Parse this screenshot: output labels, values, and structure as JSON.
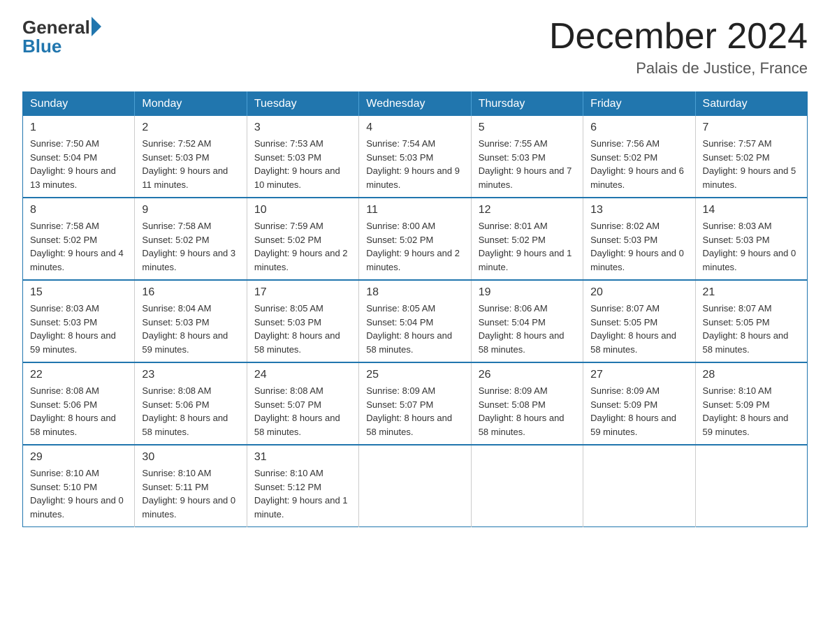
{
  "header": {
    "logo_general": "General",
    "logo_blue": "Blue",
    "month_title": "December 2024",
    "location": "Palais de Justice, France"
  },
  "days_of_week": [
    "Sunday",
    "Monday",
    "Tuesday",
    "Wednesday",
    "Thursday",
    "Friday",
    "Saturday"
  ],
  "weeks": [
    [
      {
        "day": "1",
        "sunrise": "7:50 AM",
        "sunset": "5:04 PM",
        "daylight": "9 hours and 13 minutes."
      },
      {
        "day": "2",
        "sunrise": "7:52 AM",
        "sunset": "5:03 PM",
        "daylight": "9 hours and 11 minutes."
      },
      {
        "day": "3",
        "sunrise": "7:53 AM",
        "sunset": "5:03 PM",
        "daylight": "9 hours and 10 minutes."
      },
      {
        "day": "4",
        "sunrise": "7:54 AM",
        "sunset": "5:03 PM",
        "daylight": "9 hours and 9 minutes."
      },
      {
        "day": "5",
        "sunrise": "7:55 AM",
        "sunset": "5:03 PM",
        "daylight": "9 hours and 7 minutes."
      },
      {
        "day": "6",
        "sunrise": "7:56 AM",
        "sunset": "5:02 PM",
        "daylight": "9 hours and 6 minutes."
      },
      {
        "day": "7",
        "sunrise": "7:57 AM",
        "sunset": "5:02 PM",
        "daylight": "9 hours and 5 minutes."
      }
    ],
    [
      {
        "day": "8",
        "sunrise": "7:58 AM",
        "sunset": "5:02 PM",
        "daylight": "9 hours and 4 minutes."
      },
      {
        "day": "9",
        "sunrise": "7:58 AM",
        "sunset": "5:02 PM",
        "daylight": "9 hours and 3 minutes."
      },
      {
        "day": "10",
        "sunrise": "7:59 AM",
        "sunset": "5:02 PM",
        "daylight": "9 hours and 2 minutes."
      },
      {
        "day": "11",
        "sunrise": "8:00 AM",
        "sunset": "5:02 PM",
        "daylight": "9 hours and 2 minutes."
      },
      {
        "day": "12",
        "sunrise": "8:01 AM",
        "sunset": "5:02 PM",
        "daylight": "9 hours and 1 minute."
      },
      {
        "day": "13",
        "sunrise": "8:02 AM",
        "sunset": "5:03 PM",
        "daylight": "9 hours and 0 minutes."
      },
      {
        "day": "14",
        "sunrise": "8:03 AM",
        "sunset": "5:03 PM",
        "daylight": "9 hours and 0 minutes."
      }
    ],
    [
      {
        "day": "15",
        "sunrise": "8:03 AM",
        "sunset": "5:03 PM",
        "daylight": "8 hours and 59 minutes."
      },
      {
        "day": "16",
        "sunrise": "8:04 AM",
        "sunset": "5:03 PM",
        "daylight": "8 hours and 59 minutes."
      },
      {
        "day": "17",
        "sunrise": "8:05 AM",
        "sunset": "5:03 PM",
        "daylight": "8 hours and 58 minutes."
      },
      {
        "day": "18",
        "sunrise": "8:05 AM",
        "sunset": "5:04 PM",
        "daylight": "8 hours and 58 minutes."
      },
      {
        "day": "19",
        "sunrise": "8:06 AM",
        "sunset": "5:04 PM",
        "daylight": "8 hours and 58 minutes."
      },
      {
        "day": "20",
        "sunrise": "8:07 AM",
        "sunset": "5:05 PM",
        "daylight": "8 hours and 58 minutes."
      },
      {
        "day": "21",
        "sunrise": "8:07 AM",
        "sunset": "5:05 PM",
        "daylight": "8 hours and 58 minutes."
      }
    ],
    [
      {
        "day": "22",
        "sunrise": "8:08 AM",
        "sunset": "5:06 PM",
        "daylight": "8 hours and 58 minutes."
      },
      {
        "day": "23",
        "sunrise": "8:08 AM",
        "sunset": "5:06 PM",
        "daylight": "8 hours and 58 minutes."
      },
      {
        "day": "24",
        "sunrise": "8:08 AM",
        "sunset": "5:07 PM",
        "daylight": "8 hours and 58 minutes."
      },
      {
        "day": "25",
        "sunrise": "8:09 AM",
        "sunset": "5:07 PM",
        "daylight": "8 hours and 58 minutes."
      },
      {
        "day": "26",
        "sunrise": "8:09 AM",
        "sunset": "5:08 PM",
        "daylight": "8 hours and 58 minutes."
      },
      {
        "day": "27",
        "sunrise": "8:09 AM",
        "sunset": "5:09 PM",
        "daylight": "8 hours and 59 minutes."
      },
      {
        "day": "28",
        "sunrise": "8:10 AM",
        "sunset": "5:09 PM",
        "daylight": "8 hours and 59 minutes."
      }
    ],
    [
      {
        "day": "29",
        "sunrise": "8:10 AM",
        "sunset": "5:10 PM",
        "daylight": "9 hours and 0 minutes."
      },
      {
        "day": "30",
        "sunrise": "8:10 AM",
        "sunset": "5:11 PM",
        "daylight": "9 hours and 0 minutes."
      },
      {
        "day": "31",
        "sunrise": "8:10 AM",
        "sunset": "5:12 PM",
        "daylight": "9 hours and 1 minute."
      },
      null,
      null,
      null,
      null
    ]
  ]
}
